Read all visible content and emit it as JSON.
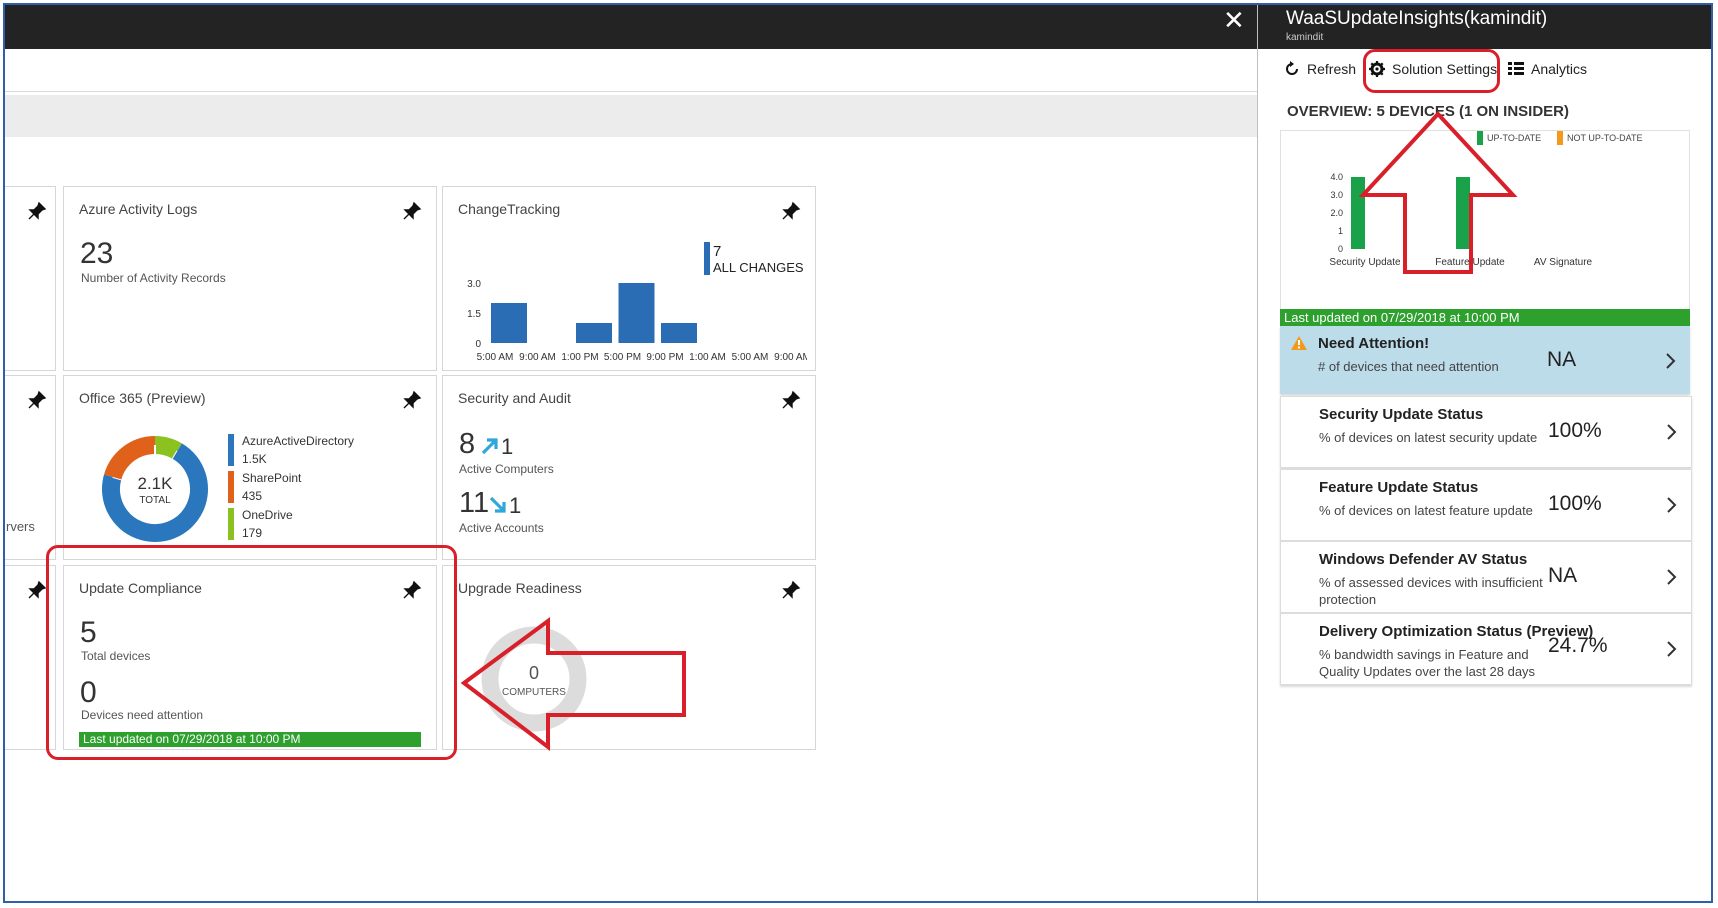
{
  "header": {
    "close_glyph": "✕"
  },
  "tiles": {
    "partial_left": {
      "label": "rvers"
    },
    "activity": {
      "title": "Azure Activity Logs",
      "value": "23",
      "caption": "Number of Activity Records"
    },
    "change": {
      "title": "ChangeTracking",
      "legend_value": "7",
      "legend_label": "ALL CHANGES",
      "chart_data": {
        "type": "bar",
        "categories": [
          "5:00 AM",
          "9:00 AM",
          "1:00 PM",
          "5:00 PM",
          "9:00 PM",
          "1:00 AM",
          "5:00 AM",
          "9:00 AM"
        ],
        "values": [
          2,
          0,
          1,
          3,
          1,
          0,
          0,
          0
        ],
        "ylim": [
          0,
          3
        ],
        "yticks": [
          "3.0",
          "1.5",
          "0"
        ]
      }
    },
    "office": {
      "title": "Office 365 (Preview)",
      "total_value": "2.1K",
      "total_label": "TOTAL",
      "chart_data": {
        "type": "pie",
        "labels": [
          "AzureActiveDirectory",
          "SharePoint",
          "OneDrive"
        ],
        "values": [
          1500,
          435,
          179
        ],
        "value_labels": [
          "1.5K",
          "435",
          "179"
        ],
        "colors": [
          "#2b77be",
          "#e0621a",
          "#8cc21f"
        ]
      }
    },
    "security": {
      "title": "Security and Audit",
      "computers_value": "8",
      "computers_delta": "1",
      "computers_label": "Active Computers",
      "accounts_value": "11",
      "accounts_delta": "1",
      "accounts_label": "Active Accounts"
    },
    "compliance": {
      "title": "Update Compliance",
      "total_value": "5",
      "total_label": "Total devices",
      "attention_value": "0",
      "attention_label": "Devices need attention",
      "updated": "Last updated on 07/29/2018 at 10:00 PM"
    },
    "upgrade": {
      "title": "Upgrade Readiness",
      "value": "0",
      "label": "COMPUTERS"
    }
  },
  "panel": {
    "title": "WaaSUpdateInsights(kamindit)",
    "subtitle": "kamindit",
    "toolbar": {
      "refresh": "Refresh",
      "settings": "Solution Settings",
      "analytics": "Analytics"
    },
    "overview": "OVERVIEW: 5 DEVICES (1 ON INSIDER)",
    "chart_data": {
      "type": "bar",
      "categories": [
        "Security Update",
        "Feature Update",
        "AV Signature"
      ],
      "series": [
        {
          "name": "UP-TO-DATE",
          "values": [
            4,
            4,
            0
          ],
          "color": "#1aa24a"
        },
        {
          "name": "NOT UP-TO-DATE",
          "values": [
            0,
            0,
            0
          ],
          "color": "#f39a1c"
        }
      ],
      "ylim": [
        0,
        4
      ],
      "yticks": [
        "4.0",
        "3.0",
        "2.0",
        "1",
        "0"
      ]
    },
    "updated": "Last updated on 07/29/2018 at 10:00 PM",
    "cards": [
      {
        "title": "Need Attention!",
        "desc": [
          "# of devices that need attention"
        ],
        "value": "NA"
      },
      {
        "title": "Security Update Status",
        "desc": [
          "% of devices on latest security update"
        ],
        "value": "100%"
      },
      {
        "title": "Feature Update Status",
        "desc": [
          "% of devices on latest feature update"
        ],
        "value": "100%"
      },
      {
        "title": "Windows Defender AV Status",
        "desc": [
          "% of assessed devices with insufficient",
          "protection"
        ],
        "value": "NA"
      },
      {
        "title": "Delivery Optimization Status (Preview)",
        "desc": [
          "% bandwidth savings in Feature and",
          "Quality Updates over the last 28 days"
        ],
        "value": "24.7%"
      }
    ]
  }
}
